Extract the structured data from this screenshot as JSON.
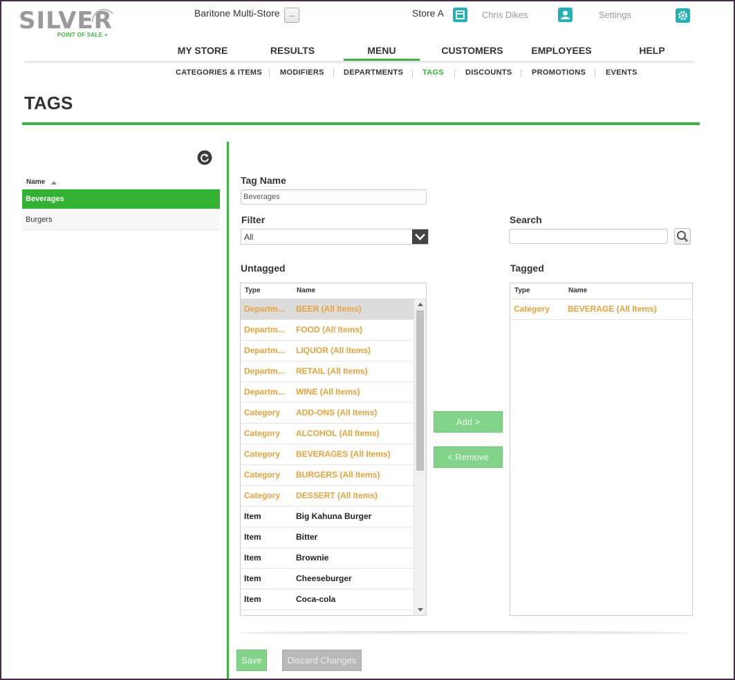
{
  "brand": {
    "name": "SILVER",
    "tagline": "POINT OF SALE +"
  },
  "topbar": {
    "store_name": "Baritone Multi-Store",
    "more_label": "...",
    "store": "Store A",
    "user": "Chris Dikes",
    "settings": "Settings"
  },
  "nav": {
    "main": [
      "MY STORE",
      "RESULTS",
      "MENU",
      "CUSTOMERS",
      "EMPLOYEES",
      "HELP"
    ],
    "active_main": "MENU",
    "sub": [
      "CATEGORIES & ITEMS",
      "MODIFIERS",
      "DEPARTMENTS",
      "TAGS",
      "DISCOUNTS",
      "PROMOTIONS",
      "EVENTS"
    ],
    "active_sub": "TAGS"
  },
  "page": {
    "title": "TAGS"
  },
  "tag_list": {
    "header": "Name",
    "items": [
      "Beverages",
      "Burgers"
    ],
    "selected": "Beverages"
  },
  "form": {
    "tag_name_label": "Tag Name",
    "tag_name_value": "Beverages",
    "filter_label": "Filter",
    "filter_value": "All",
    "search_label": "Search",
    "search_value": "",
    "untagged_label": "Untagged",
    "tagged_label": "Tagged",
    "col_type": "Type",
    "col_name": "Name",
    "add_label": "Add >",
    "remove_label": "< Remove",
    "save_label": "Save",
    "discard_label": "Discard Changes"
  },
  "untagged": [
    {
      "type": "Departm...",
      "name": "BEER (All Items)"
    },
    {
      "type": "Departm...",
      "name": "FOOD (All Items)"
    },
    {
      "type": "Departm...",
      "name": "LIQUOR (All Items)"
    },
    {
      "type": "Departm...",
      "name": "RETAIL (All Items)"
    },
    {
      "type": "Departm...",
      "name": "WINE (All Items)"
    },
    {
      "type": "Category",
      "name": "ADD-ONS (All Items)"
    },
    {
      "type": "Category",
      "name": "ALCOHOL (All Items)"
    },
    {
      "type": "Category",
      "name": "BEVERAGES (All Items)"
    },
    {
      "type": "Category",
      "name": "BURGERS (All Items)"
    },
    {
      "type": "Category",
      "name": "DESSERT (All Items)"
    },
    {
      "type": "Item",
      "name": "Big Kahuna Burger"
    },
    {
      "type": "Item",
      "name": "Bitter"
    },
    {
      "type": "Item",
      "name": "Brownie"
    },
    {
      "type": "Item",
      "name": "Cheeseburger"
    },
    {
      "type": "Item",
      "name": "Coca-cola"
    }
  ],
  "tagged": [
    {
      "type": "Category",
      "name": "BEVERAGE (All Items)"
    }
  ],
  "colors": {
    "accent": "#3cb53c",
    "orange": "#e8a33a",
    "teal": "#1fb2b8"
  }
}
